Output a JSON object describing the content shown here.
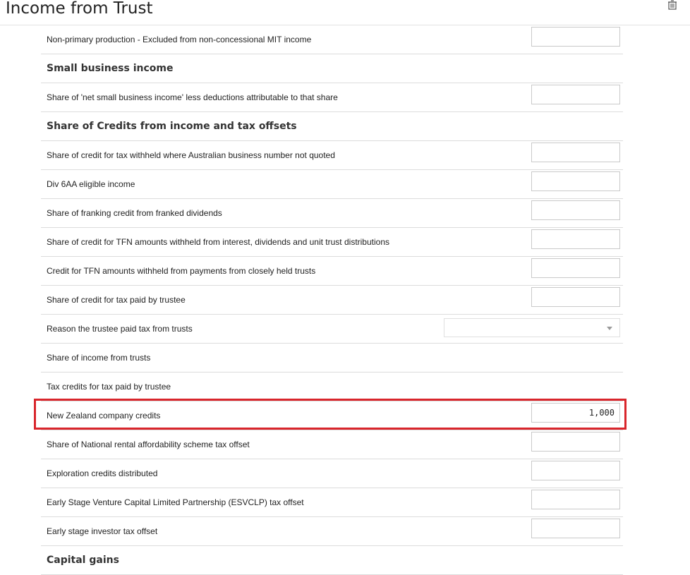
{
  "header": {
    "title": "Income from Trust",
    "delete_icon": "trash-icon"
  },
  "rows": [
    {
      "label": "Non-primary production - Excluded from non-concessional MIT income",
      "type": "input",
      "value": ""
    },
    {
      "label": "Small business income",
      "type": "section"
    },
    {
      "label": "Share of 'net small business income' less deductions attributable to that share",
      "type": "input",
      "value": ""
    },
    {
      "label": "Share of Credits from income and tax offsets",
      "type": "section"
    },
    {
      "label": "Share of credit for tax withheld where Australian business number not quoted",
      "type": "input",
      "value": ""
    },
    {
      "label": "Div 6AA eligible income",
      "type": "input",
      "value": ""
    },
    {
      "label": "Share of franking credit from franked dividends",
      "type": "input",
      "value": ""
    },
    {
      "label": "Share of credit for TFN amounts withheld from interest, dividends and unit trust distributions",
      "type": "input",
      "value": ""
    },
    {
      "label": "Credit for TFN amounts withheld from payments from closely held trusts",
      "type": "input",
      "value": ""
    },
    {
      "label": "Share of credit for tax paid by trustee",
      "type": "input",
      "value": ""
    },
    {
      "label": "Reason the trustee paid tax from trusts",
      "type": "select",
      "value": ""
    },
    {
      "label": "Share of income from trusts",
      "type": "text"
    },
    {
      "label": "Tax credits for tax paid by trustee",
      "type": "text"
    },
    {
      "label": "New Zealand company credits",
      "type": "input",
      "value": "1,000"
    },
    {
      "label": "Share of National rental affordability scheme tax offset",
      "type": "input",
      "value": ""
    },
    {
      "label": "Exploration credits distributed",
      "type": "input",
      "value": ""
    },
    {
      "label": "Early Stage Venture Capital Limited Partnership (ESVCLP) tax offset",
      "type": "input",
      "value": ""
    },
    {
      "label": "Early stage investor tax offset",
      "type": "input",
      "value": ""
    },
    {
      "label": "Capital gains",
      "type": "section"
    }
  ],
  "highlight_color": "#d9262c"
}
